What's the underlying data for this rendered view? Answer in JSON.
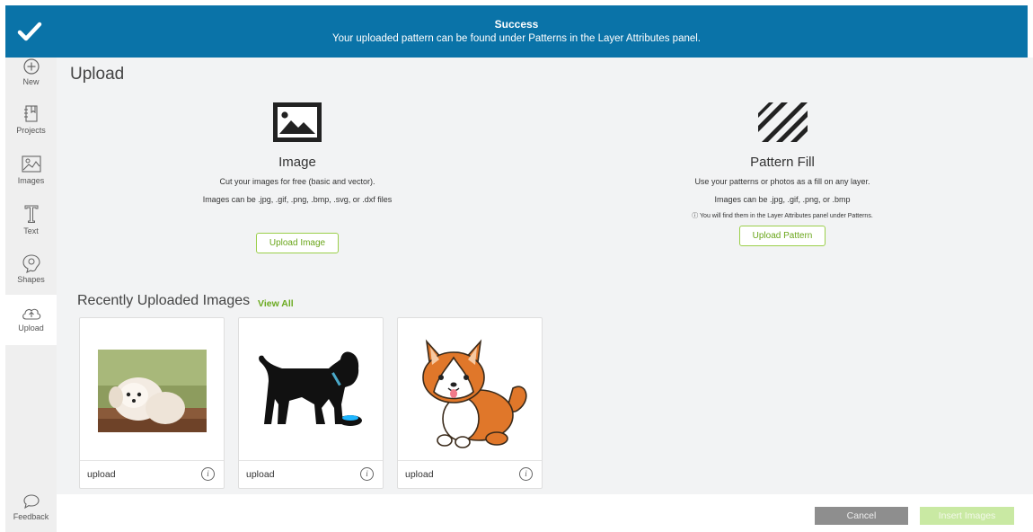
{
  "banner": {
    "title": "Success",
    "message": "Your uploaded pattern can be found under Patterns in the Layer Attributes panel.",
    "color": "#0a73a8"
  },
  "sidebar": {
    "items": [
      {
        "label": "New",
        "icon": "plus-circle-icon"
      },
      {
        "label": "Projects",
        "icon": "projects-icon"
      },
      {
        "label": "Images",
        "icon": "images-icon"
      },
      {
        "label": "Text",
        "icon": "text-icon"
      },
      {
        "label": "Shapes",
        "icon": "shapes-icon"
      },
      {
        "label": "Upload",
        "icon": "upload-cloud-icon",
        "active": true
      }
    ],
    "feedback": {
      "label": "Feedback",
      "icon": "speech-bubble-icon"
    }
  },
  "main": {
    "title": "Upload",
    "image_section": {
      "heading": "Image",
      "line1": "Cut your images for free (basic and vector).",
      "line2": "Images can be .jpg, .gif, .png, .bmp, .svg, or .dxf files",
      "button": "Upload Image"
    },
    "pattern_section": {
      "heading": "Pattern Fill",
      "line1": "Use your patterns or photos as a fill on any layer.",
      "line2": "Images can be .jpg, .gif, .png, or .bmp",
      "note": "ⓘ You will find them in the Layer Attributes panel under Patterns.",
      "button": "Upload Pattern"
    },
    "recent": {
      "title": "Recently Uploaded Images",
      "view_all": "View All",
      "cards": [
        {
          "label": "upload",
          "image": "white puppy photo"
        },
        {
          "label": "upload",
          "image": "black dog silhouette with bowl"
        },
        {
          "label": "upload",
          "image": "corgi cartoon"
        }
      ]
    }
  },
  "footer": {
    "cancel": "Cancel",
    "insert": "Insert Images"
  },
  "colors": {
    "accent_green": "#9bcf4a",
    "banner_blue": "#0a73a8"
  }
}
